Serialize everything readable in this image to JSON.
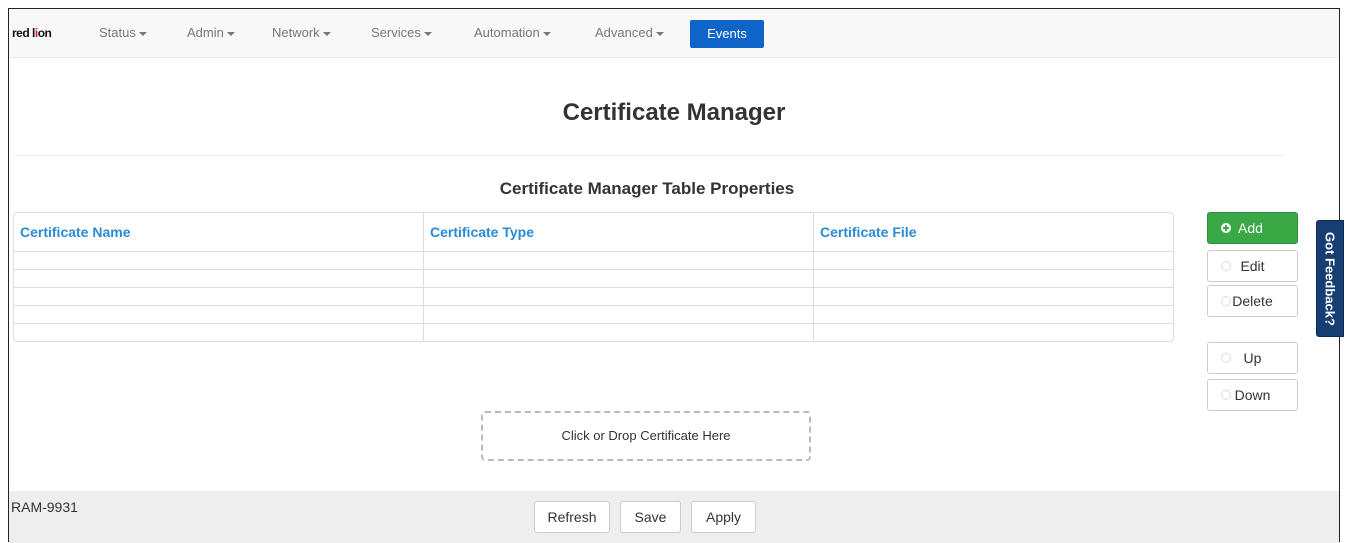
{
  "brand": {
    "name_part1": "red l",
    "name_part2": "i",
    "name_part3": "on"
  },
  "nav": {
    "items": [
      {
        "label": "Status"
      },
      {
        "label": "Admin"
      },
      {
        "label": "Network"
      },
      {
        "label": "Services"
      },
      {
        "label": "Automation"
      },
      {
        "label": "Advanced"
      }
    ],
    "active": "Events"
  },
  "page": {
    "title": "Certificate Manager",
    "subtitle": "Certificate Manager Table Properties"
  },
  "table": {
    "headers": [
      "Certificate Name",
      "Certificate Type",
      "Certificate File"
    ]
  },
  "side_buttons": {
    "add": "Add",
    "edit": "Edit",
    "delete": "Delete",
    "up": "Up",
    "down": "Down"
  },
  "feedback": "Got Feedback?",
  "drop_zone": "Click or Drop Certificate Here",
  "footer": {
    "device": "RAM-9931",
    "refresh": "Refresh",
    "save": "Save",
    "apply": "Apply"
  },
  "colors": {
    "accent": "#0e64c8",
    "header_text": "#2a8ad3",
    "add_green": "#3aa845",
    "feedback_bg": "#173e73"
  }
}
